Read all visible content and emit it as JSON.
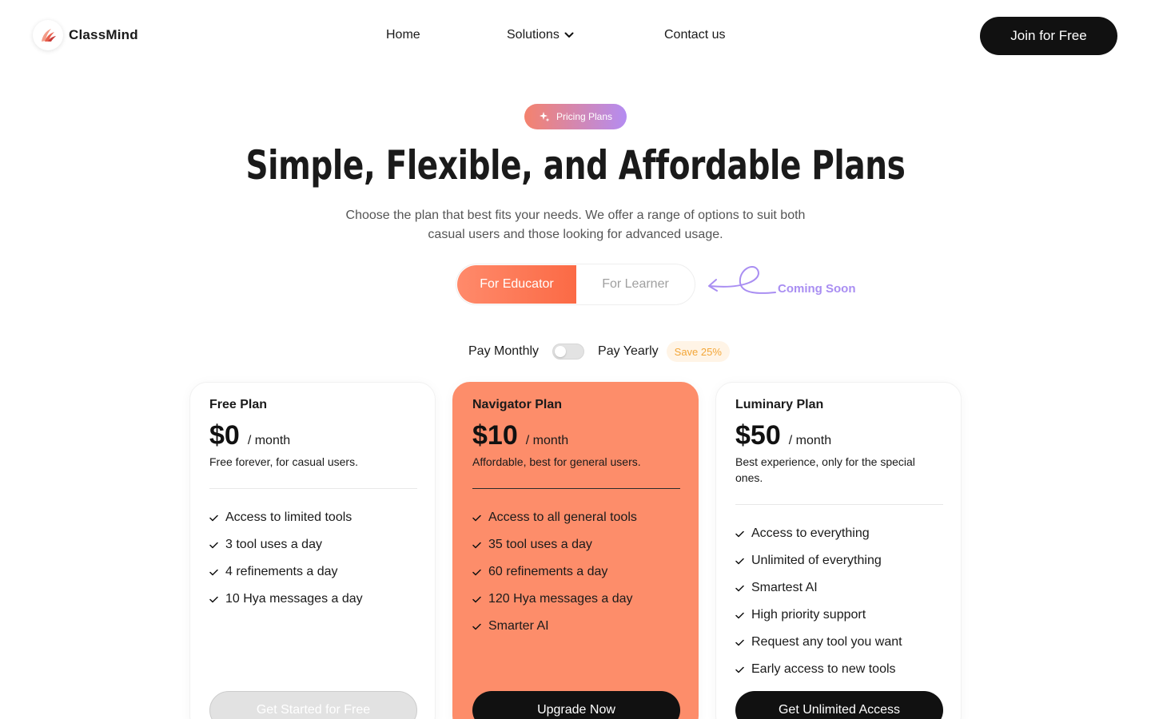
{
  "brand": {
    "name": "ClassMind"
  },
  "nav": {
    "home": "Home",
    "solutions": "Solutions",
    "contact": "Contact us",
    "cta": "Join for Free"
  },
  "hero": {
    "badge": "Pricing Plans",
    "title": "Simple, Flexible, and Affordable Plans",
    "subtitle": "Choose the plan that best fits your needs. We offer a range of options to suit both casual users and those looking for advanced usage."
  },
  "audience": {
    "educator": "For Educator",
    "learner": "For Learner",
    "coming_soon": "Coming Soon",
    "selected": "For Educator"
  },
  "billing": {
    "monthly": "Pay Monthly",
    "yearly": "Pay Yearly",
    "save": "Save 25%",
    "yearly_enabled": false
  },
  "plans": [
    {
      "name": "Free Plan",
      "price": "$0",
      "per": "/ month",
      "description": "Free forever, for casual users.",
      "features": [
        "Access to limited tools",
        "3 tool uses a day",
        "4 refinements a day",
        "10 Hya messages a day"
      ],
      "cta": "Get Started for Free"
    },
    {
      "name": "Navigator Plan",
      "price": "$10",
      "per": "/ month",
      "description": "Affordable, best for general users.",
      "features": [
        "Access to all general tools",
        "35 tool uses a day",
        "60 refinements a day",
        "120 Hya messages a day",
        "Smarter AI"
      ],
      "cta": "Upgrade Now"
    },
    {
      "name": "Luminary Plan",
      "price": "$50",
      "per": "/ month",
      "description": "Best experience, only for the special ones.",
      "features": [
        "Access to everything",
        "Unlimited of everything",
        "Smartest AI",
        "High priority support",
        "Request any tool you want",
        "Early access to new tools"
      ],
      "cta": "Get Unlimited Access"
    }
  ],
  "colors": {
    "accent": "#fb6a45",
    "featured_card": "#fd8d6a",
    "coming_soon": "#a98ef2",
    "save_text": "#f3a638"
  },
  "icons": {
    "logo": "wing-logo-icon",
    "solutions_caret": "chevron-down-icon",
    "badge": "sparkle-icon",
    "feature": "check-icon"
  }
}
